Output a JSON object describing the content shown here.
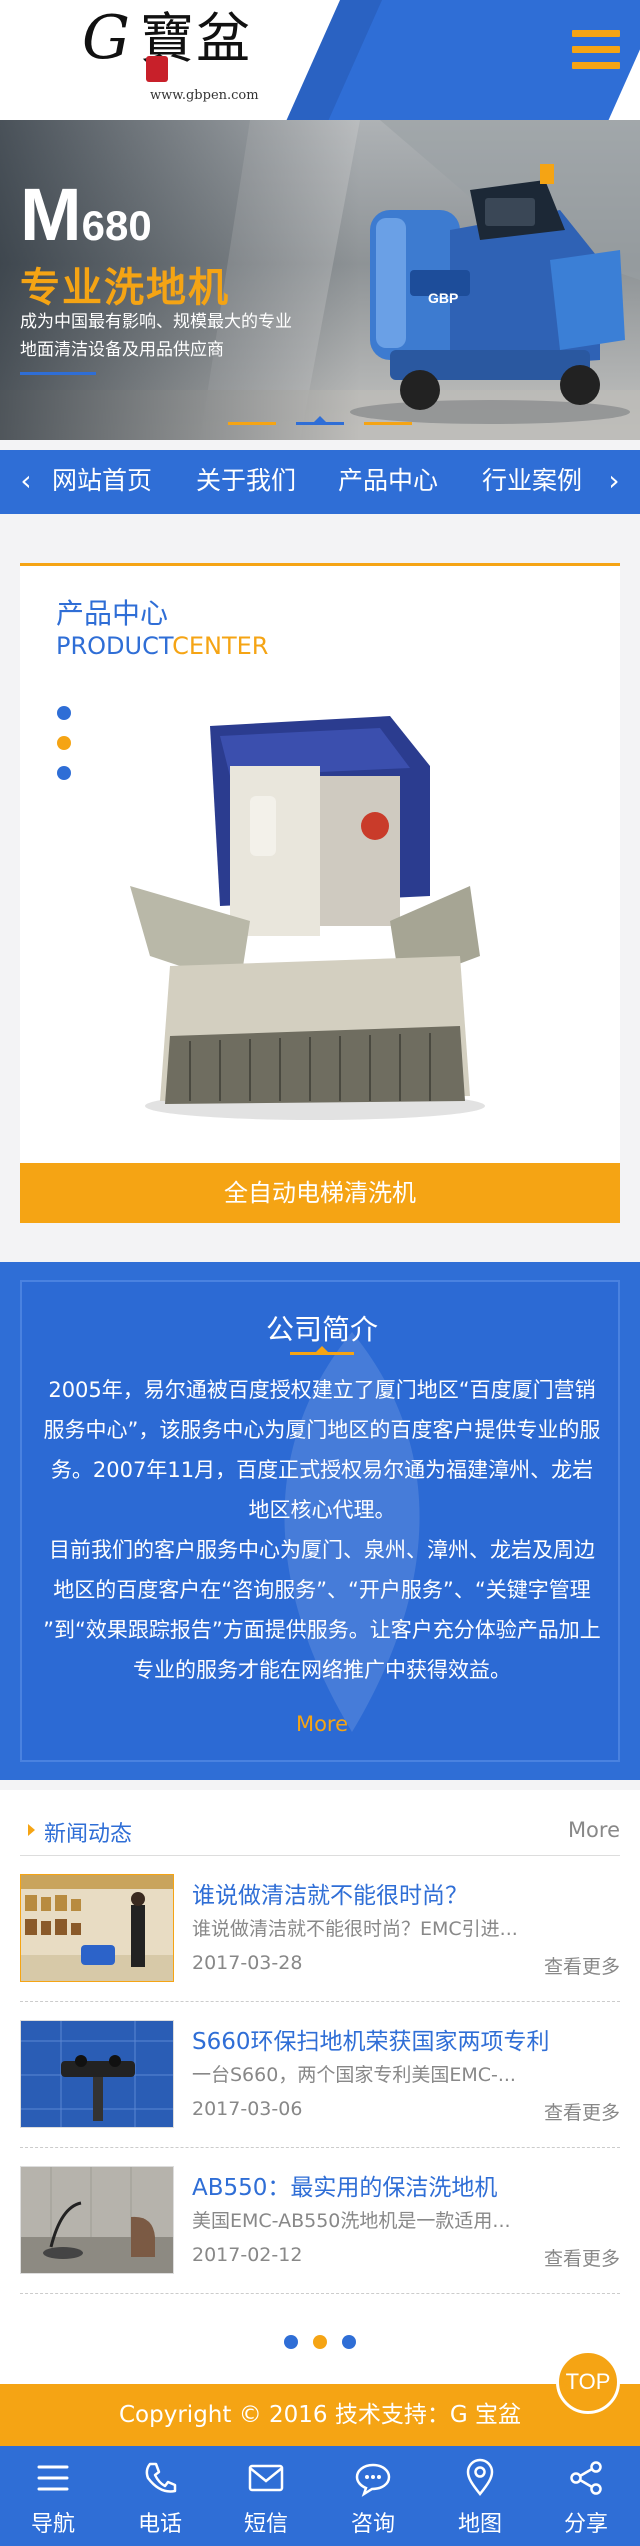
{
  "header": {
    "logo_letter": "G",
    "logo_cn": "寶盆",
    "logo_url": "www.gbpen.com",
    "menu_icon": "hamburger-icon"
  },
  "banner": {
    "model_letter": "M",
    "model_number": "680",
    "title": "专业洗地机",
    "desc_line1": "成为中国最有影响、规模最大的专业",
    "desc_line2": "地面清洁设备及用品供应商",
    "machine_badge": "GBP",
    "active_slide": 2,
    "slide_count": 3
  },
  "nav": {
    "items": [
      "网站首页",
      "关于我们",
      "产品中心",
      "行业案例"
    ],
    "prev_icon": "chevron-left-icon",
    "next_icon": "chevron-right-icon"
  },
  "product": {
    "title": "产品中心",
    "subtitle_blue": "PRODUCT",
    "subtitle_orange": "CENTER",
    "caption": "全自动电梯清洗机"
  },
  "about": {
    "title": "公司简介",
    "para1": "2005年，易尔通被百度授权建立了厦门地区“百度厦门营销服务中心”，该服务中心为厦门地区的百度客户提供专业的服务。2007年11月，百度正式授权易尔通为福建漳州、龙岩地区核心代理。",
    "para2": "目前我们的客户服务中心为厦门、泉州、漳州、龙岩及周边地区的百度客户在“咨询服务”、“开户服务”、“关键字管理 ”到“效果跟踪报告”方面提供服务。让客户充分体验产品加上专业的服务才能在网络推广中获得效益。",
    "more": "More"
  },
  "news": {
    "title": "新闻动态",
    "more": "More",
    "items": [
      {
        "title": "谁说做清洁就不能很时尚？",
        "summary": "谁说做清洁就不能很时尚？EMC引进...",
        "date": "2017-03-28",
        "more": "查看更多"
      },
      {
        "title": "S660环保扫地机荣获国家两项专利",
        "summary": "一台S660，两个国家专利美国EMC-...",
        "date": "2017-03-06",
        "more": "查看更多"
      },
      {
        "title": "AB550：最实用的保洁洗地机",
        "summary": "美国EMC-AB550洗地机是一款适用...",
        "date": "2017-02-12",
        "more": "查看更多"
      }
    ]
  },
  "footer": {
    "copyright": "Copyright © 2016  技术支持：G 宝盆",
    "top": "TOP"
  },
  "tabbar": {
    "items": [
      {
        "label": "导航",
        "icon": "menu-icon"
      },
      {
        "label": "电话",
        "icon": "phone-icon"
      },
      {
        "label": "短信",
        "icon": "envelope-icon"
      },
      {
        "label": "咨询",
        "icon": "chat-icon"
      },
      {
        "label": "地图",
        "icon": "map-pin-icon"
      },
      {
        "label": "分享",
        "icon": "share-icon"
      }
    ]
  },
  "colors": {
    "brand_blue": "#2f6ed6",
    "accent_orange": "#f5a414"
  }
}
